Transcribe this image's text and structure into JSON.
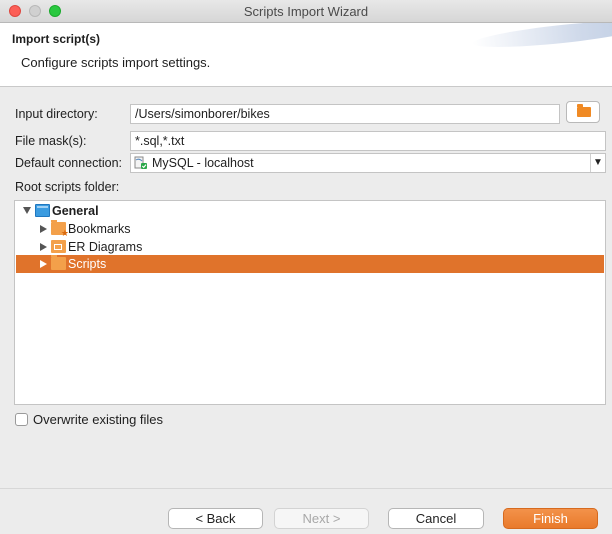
{
  "window": {
    "title": "Scripts Import Wizard"
  },
  "header": {
    "title": "Import script(s)",
    "subtitle": "Configure scripts import settings."
  },
  "form": {
    "input_directory": {
      "label": "Input directory:",
      "value": "/Users/simonborer/bikes"
    },
    "file_mask": {
      "label": "File mask(s):",
      "value": "*.sql,*.txt"
    },
    "default_connection": {
      "label": "Default connection:",
      "value": "MySQL - localhost"
    },
    "root_folder_label": "Root scripts folder:"
  },
  "tree": {
    "root": {
      "label": "General",
      "expanded": true
    },
    "children": [
      {
        "label": "Bookmarks",
        "icon": "bookmarks-folder-icon",
        "selected": false
      },
      {
        "label": "ER Diagrams",
        "icon": "er-diagrams-folder-icon",
        "selected": false
      },
      {
        "label": "Scripts",
        "icon": "scripts-folder-icon",
        "selected": true
      }
    ]
  },
  "options": {
    "overwrite_label": "Overwrite existing files",
    "overwrite_checked": false
  },
  "buttons": {
    "back": "< Back",
    "next": "Next >",
    "cancel": "Cancel",
    "finish": "Finish"
  },
  "colors": {
    "accent": "#e0732b",
    "folder": "#f3a04a",
    "general_icon": "#3a9be0"
  }
}
